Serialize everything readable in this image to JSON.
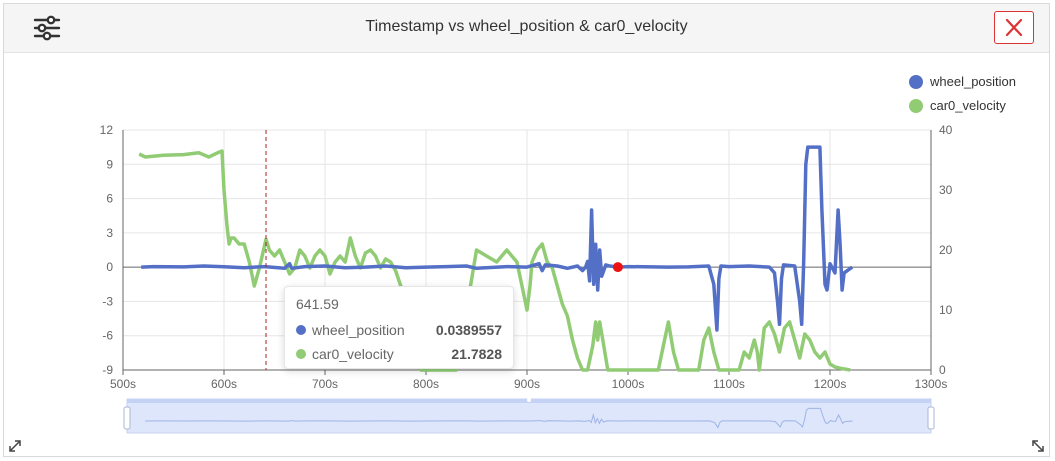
{
  "header": {
    "title": "Timestamp vs wheel_position & car0_velocity",
    "settings_icon": "sliders-icon",
    "close_icon": "close-icon"
  },
  "tooltip": {
    "x_label": "641.59",
    "rows": [
      {
        "name": "wheel_position",
        "value": "0.0389557",
        "color": "#5470c6"
      },
      {
        "name": "car0_velocity",
        "value": "21.7828",
        "color": "#91cc75"
      }
    ]
  },
  "chart_data": {
    "type": "line",
    "title": "Timestamp vs wheel_position & car0_velocity",
    "xlabel": "",
    "x_tick_labels": [
      "500s",
      "600s",
      "700s",
      "800s",
      "900s",
      "1000s",
      "1100s",
      "1200s",
      "1300s"
    ],
    "x_ticks": [
      500,
      600,
      700,
      800,
      900,
      1000,
      1100,
      1200,
      1300
    ],
    "xlim": [
      500,
      1300
    ],
    "y_left": {
      "ticks": [
        12,
        9,
        6,
        3,
        0,
        -3,
        -6,
        -9
      ],
      "lim": [
        -9,
        12
      ]
    },
    "y_right": {
      "ticks": [
        40,
        30,
        20,
        10,
        0
      ],
      "lim": [
        0,
        40
      ]
    },
    "cursor_x": 641.59,
    "marker": {
      "x": 990,
      "y": 0,
      "color": "#ee1111"
    },
    "legend": {
      "position": "top-right"
    },
    "grid": true,
    "series": [
      {
        "name": "wheel_position",
        "axis": "left",
        "color": "#5470c6",
        "points": [
          [
            518,
            0
          ],
          [
            530,
            0.05
          ],
          [
            560,
            0.02
          ],
          [
            580,
            0.1
          ],
          [
            600,
            0.03
          ],
          [
            620,
            -0.05
          ],
          [
            640,
            0.05
          ],
          [
            660,
            -0.1
          ],
          [
            665,
            0.3
          ],
          [
            667,
            -0.1
          ],
          [
            680,
            0.05
          ],
          [
            700,
            0.1
          ],
          [
            720,
            -0.05
          ],
          [
            740,
            0
          ],
          [
            760,
            0.1
          ],
          [
            780,
            -0.05
          ],
          [
            800,
            0
          ],
          [
            820,
            0.05
          ],
          [
            840,
            0.1
          ],
          [
            850,
            -0.1
          ],
          [
            880,
            0.05
          ],
          [
            900,
            0
          ],
          [
            912,
            0.3
          ],
          [
            915,
            -0.3
          ],
          [
            918,
            0.2
          ],
          [
            930,
            0.1
          ],
          [
            940,
            -0.1
          ],
          [
            950,
            0.1
          ],
          [
            955,
            -0.3
          ],
          [
            958,
            0
          ],
          [
            960,
            0.5
          ],
          [
            962,
            -1.2
          ],
          [
            964,
            5
          ],
          [
            966,
            -1.5
          ],
          [
            968,
            2
          ],
          [
            970,
            -2
          ],
          [
            972,
            1.5
          ],
          [
            974,
            -0.8
          ],
          [
            978,
            0.2
          ],
          [
            982,
            0.1
          ],
          [
            990,
            0
          ],
          [
            1000,
            0.05
          ],
          [
            1040,
            0
          ],
          [
            1060,
            0.02
          ],
          [
            1080,
            0.1
          ],
          [
            1085,
            -1.5
          ],
          [
            1088,
            -5.5
          ],
          [
            1090,
            -1
          ],
          [
            1092,
            0.1
          ],
          [
            1100,
            0.05
          ],
          [
            1120,
            0.1
          ],
          [
            1140,
            0
          ],
          [
            1145,
            -0.5
          ],
          [
            1148,
            -3
          ],
          [
            1150,
            -5
          ],
          [
            1152,
            -1
          ],
          [
            1154,
            0.2
          ],
          [
            1165,
            0.1
          ],
          [
            1170,
            -3
          ],
          [
            1172,
            -5
          ],
          [
            1174,
            0.5
          ],
          [
            1176,
            9
          ],
          [
            1178,
            10.5
          ],
          [
            1190,
            10.5
          ],
          [
            1192,
            5
          ],
          [
            1195,
            -1.5
          ],
          [
            1197,
            -2
          ],
          [
            1200,
            0.3
          ],
          [
            1205,
            -0.5
          ],
          [
            1208,
            5
          ],
          [
            1210,
            2
          ],
          [
            1212,
            -2
          ],
          [
            1214,
            -0.5
          ],
          [
            1222,
            0
          ]
        ]
      },
      {
        "name": "car0_velocity",
        "axis": "right",
        "color": "#91cc75",
        "points": [
          [
            516,
            36
          ],
          [
            522,
            35.5
          ],
          [
            540,
            35.8
          ],
          [
            560,
            35.9
          ],
          [
            575,
            36.2
          ],
          [
            585,
            35.5
          ],
          [
            595,
            36.3
          ],
          [
            598,
            36.5
          ],
          [
            600,
            30
          ],
          [
            603,
            24
          ],
          [
            605,
            21
          ],
          [
            607,
            22
          ],
          [
            610,
            22
          ],
          [
            615,
            21
          ],
          [
            620,
            21
          ],
          [
            625,
            18
          ],
          [
            630,
            14
          ],
          [
            635,
            17
          ],
          [
            641.59,
            21.78
          ],
          [
            645,
            20
          ],
          [
            650,
            19
          ],
          [
            655,
            20
          ],
          [
            660,
            18
          ],
          [
            665,
            16
          ],
          [
            670,
            17
          ],
          [
            675,
            20
          ],
          [
            680,
            19
          ],
          [
            685,
            17
          ],
          [
            690,
            19
          ],
          [
            695,
            20
          ],
          [
            700,
            19
          ],
          [
            705,
            16
          ],
          [
            710,
            18
          ],
          [
            715,
            19
          ],
          [
            720,
            18
          ],
          [
            725,
            22
          ],
          [
            730,
            19
          ],
          [
            735,
            17
          ],
          [
            740,
            19.5
          ],
          [
            745,
            20
          ],
          [
            750,
            19
          ],
          [
            755,
            17
          ],
          [
            760,
            18.5
          ],
          [
            765,
            18
          ],
          [
            770,
            16.5
          ],
          [
            775,
            14
          ],
          [
            780,
            10
          ],
          [
            785,
            5
          ],
          [
            790,
            1
          ],
          [
            795,
            0
          ],
          [
            800,
            0
          ],
          [
            830,
            0
          ],
          [
            835,
            4
          ],
          [
            840,
            10
          ],
          [
            845,
            15
          ],
          [
            850,
            20
          ],
          [
            855,
            19.5
          ],
          [
            860,
            19
          ],
          [
            870,
            18
          ],
          [
            880,
            20
          ],
          [
            890,
            18
          ],
          [
            895,
            14
          ],
          [
            900,
            10
          ],
          [
            903,
            14
          ],
          [
            905,
            18
          ],
          [
            910,
            20
          ],
          [
            915,
            21
          ],
          [
            920,
            18
          ],
          [
            925,
            17
          ],
          [
            930,
            14
          ],
          [
            935,
            11
          ],
          [
            940,
            9
          ],
          [
            945,
            5
          ],
          [
            950,
            2
          ],
          [
            955,
            0
          ],
          [
            960,
            0
          ],
          [
            965,
            4
          ],
          [
            968,
            8
          ],
          [
            970,
            5
          ],
          [
            972,
            8
          ],
          [
            975,
            5
          ],
          [
            980,
            0
          ],
          [
            1000,
            0
          ],
          [
            1030,
            0
          ],
          [
            1035,
            4
          ],
          [
            1040,
            8
          ],
          [
            1045,
            3
          ],
          [
            1050,
            0
          ],
          [
            1060,
            0
          ],
          [
            1070,
            0
          ],
          [
            1075,
            5
          ],
          [
            1080,
            7
          ],
          [
            1085,
            3
          ],
          [
            1090,
            0
          ],
          [
            1095,
            0
          ],
          [
            1100,
            0
          ],
          [
            1110,
            0
          ],
          [
            1115,
            3
          ],
          [
            1120,
            2
          ],
          [
            1125,
            5
          ],
          [
            1128,
            3
          ],
          [
            1130,
            0
          ],
          [
            1135,
            7
          ],
          [
            1140,
            8
          ],
          [
            1145,
            6
          ],
          [
            1150,
            3
          ],
          [
            1155,
            7
          ],
          [
            1160,
            8
          ],
          [
            1165,
            5
          ],
          [
            1170,
            2
          ],
          [
            1175,
            6
          ],
          [
            1180,
            5
          ],
          [
            1185,
            3
          ],
          [
            1190,
            2
          ],
          [
            1195,
            3
          ],
          [
            1200,
            1
          ],
          [
            1205,
            0.5
          ],
          [
            1210,
            0.3
          ],
          [
            1220,
            0
          ]
        ]
      }
    ]
  }
}
